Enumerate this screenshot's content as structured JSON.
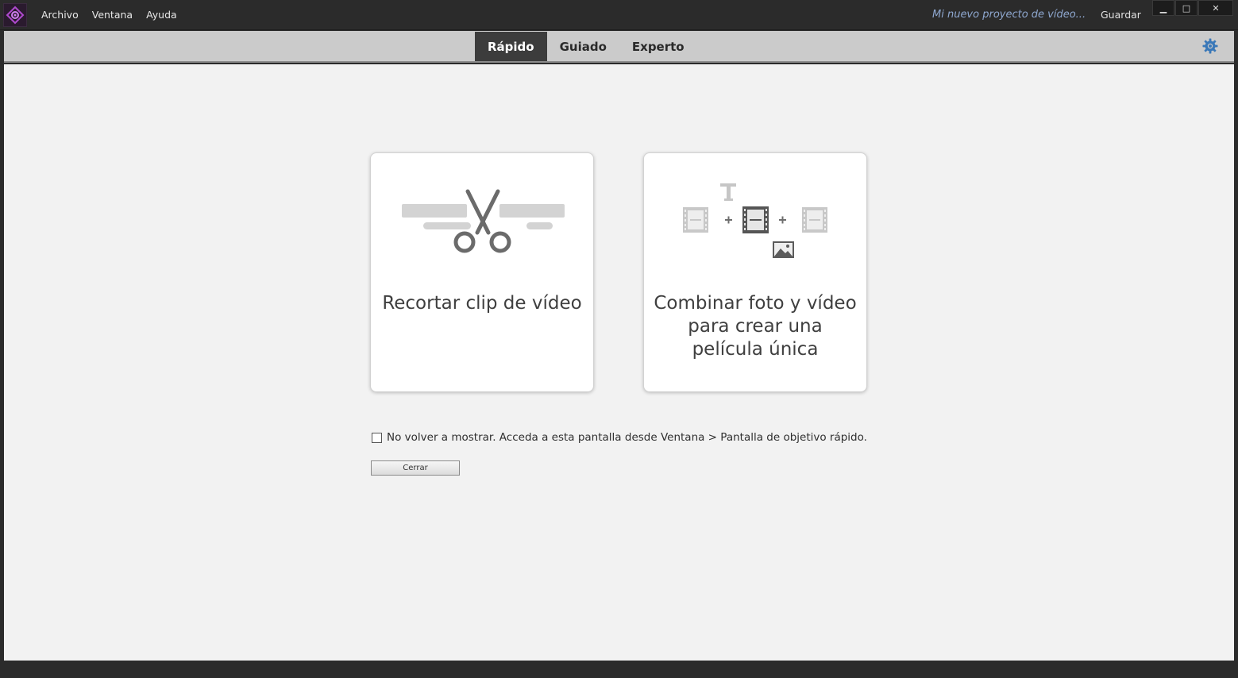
{
  "menu": {
    "items": [
      {
        "label": "Archivo"
      },
      {
        "label": "Ventana"
      },
      {
        "label": "Ayuda"
      }
    ]
  },
  "header": {
    "project_title": "Mi nuevo proyecto de vídeo...",
    "save_label": "Guardar",
    "window_controls": {
      "minimize": "▁",
      "maximize": "□",
      "close": "✕"
    }
  },
  "modes": {
    "tabs": [
      {
        "label": "Rápido",
        "active": true
      },
      {
        "label": "Guiado",
        "active": false
      },
      {
        "label": "Experto",
        "active": false
      }
    ],
    "settings_icon": "gear-icon"
  },
  "cards": {
    "trim": {
      "label": "Recortar clip de vídeo",
      "icon": "scissors-icon"
    },
    "combine": {
      "label": "Combinar foto y vídeo para crear una película única",
      "icon": "combine-media-icon"
    }
  },
  "footer": {
    "dont_show_label": "No volver a mostrar. Acceda a esta pantalla desde Ventana > Pantalla de objetivo rápido.",
    "dont_show_checked": false,
    "close_label": "Cerrar"
  },
  "colors": {
    "accent_active_tab": "#3c3c3c",
    "gear": "#3a78b8",
    "project_title": "#8fa8d0",
    "logo": "#b04ad0"
  }
}
